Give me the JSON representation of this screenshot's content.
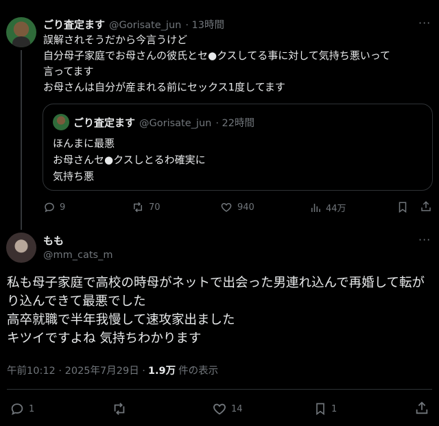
{
  "original_tweet": {
    "author_name": "ごり査定ます",
    "handle": "@Gorisate_jun",
    "time": "· 13時間",
    "more": "···",
    "text": "誤解されそうだから今言うけど\n自分母子家庭でお母さんの彼氏とセ●クスしてる事に対して気持ち悪いって\n言ってます\nお母さんは自分が産まれる前にセックス1度してます",
    "quote": {
      "author_name": "ごり査定ます",
      "handle": "@Gorisate_jun",
      "time": "· 22時間",
      "text": "ほんまに最悪\nお母さんセ●クスしとるわ確実に\n気持ち悪"
    },
    "actions": {
      "replies": "9",
      "reposts": "70",
      "likes": "940",
      "views": "44万"
    }
  },
  "reply_tweet": {
    "author_name": "もも",
    "handle": "@mm_cats_m",
    "more": "···",
    "text": "私も母子家庭で高校の時母がネットで出会った男連れ込んで再婚して転が\nり込んできて最悪でした\n高卒就職で半年我慢して速攻家出ました\nキツイですよね 気持ちわかります",
    "timestamp": "午前10:12 · 2025年7月29日 ·",
    "view_count": "1.9万",
    "view_label": "件の表示",
    "actions": {
      "replies": "1",
      "reposts": "",
      "likes": "14",
      "bookmarks": "1"
    }
  },
  "colors": {
    "background": "#000000",
    "text": "#e7e9ea",
    "muted": "#71767b",
    "border": "#2f3336"
  }
}
